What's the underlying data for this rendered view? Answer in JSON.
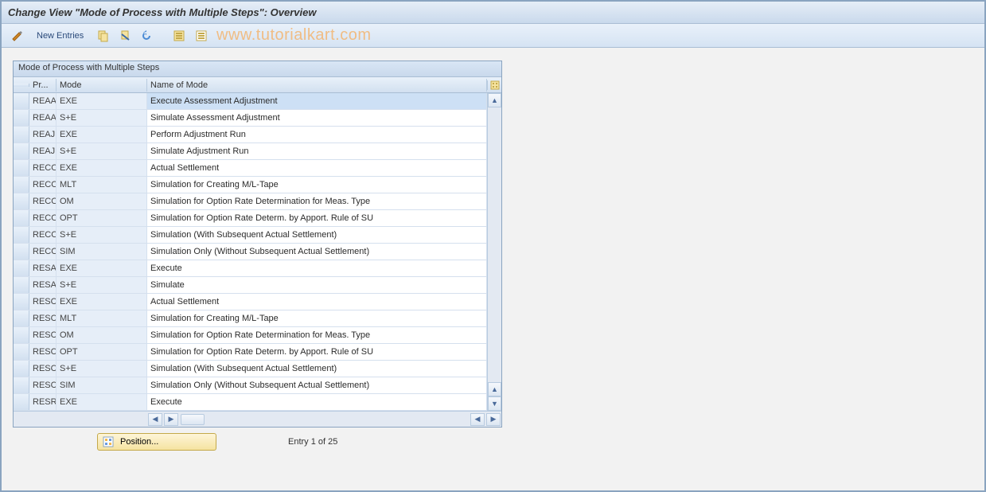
{
  "title": "Change View \"Mode of Process with Multiple Steps\": Overview",
  "toolbar": {
    "new_entries": "New Entries"
  },
  "watermark": "www.tutorialkart.com",
  "table": {
    "caption": "Mode of Process with Multiple Steps",
    "headers": {
      "pr": "Pr...",
      "mode": "Mode",
      "name": "Name of Mode"
    },
    "rows": [
      {
        "pr": "REAA",
        "mode": "EXE",
        "name": "Execute Assessment Adjustment",
        "highlight": true
      },
      {
        "pr": "REAA",
        "mode": "S+E",
        "name": "Simulate Assessment Adjustment"
      },
      {
        "pr": "REAJ",
        "mode": "EXE",
        "name": "Perform Adjustment Run"
      },
      {
        "pr": "REAJ",
        "mode": "S+E",
        "name": "Simulate Adjustment Run"
      },
      {
        "pr": "RECO",
        "mode": "EXE",
        "name": "Actual Settlement"
      },
      {
        "pr": "RECO",
        "mode": "MLT",
        "name": "Simulation for Creating M/L-Tape"
      },
      {
        "pr": "RECO",
        "mode": "OM",
        "name": "Simulation for Option Rate Determination for Meas. Type"
      },
      {
        "pr": "RECO",
        "mode": "OPT",
        "name": "Simulation for Option Rate Determ. by Apport. Rule of SU"
      },
      {
        "pr": "RECO",
        "mode": "S+E",
        "name": "Simulation (With Subsequent Actual Settlement)"
      },
      {
        "pr": "RECO",
        "mode": "SIM",
        "name": "Simulation Only (Without Subsequent Actual Settlement)"
      },
      {
        "pr": "RESA",
        "mode": "EXE",
        "name": "Execute"
      },
      {
        "pr": "RESA",
        "mode": "S+E",
        "name": "Simulate"
      },
      {
        "pr": "RESC",
        "mode": "EXE",
        "name": "Actual Settlement"
      },
      {
        "pr": "RESC",
        "mode": "MLT",
        "name": "Simulation for Creating M/L-Tape"
      },
      {
        "pr": "RESC",
        "mode": "OM",
        "name": "Simulation for Option Rate Determination for Meas. Type"
      },
      {
        "pr": "RESC",
        "mode": "OPT",
        "name": "Simulation for Option Rate Determ. by Apport. Rule of SU"
      },
      {
        "pr": "RESC",
        "mode": "S+E",
        "name": "Simulation (With Subsequent Actual Settlement)"
      },
      {
        "pr": "RESC",
        "mode": "SIM",
        "name": "Simulation Only (Without Subsequent Actual Settlement)"
      },
      {
        "pr": "RESR",
        "mode": "EXE",
        "name": "Execute"
      }
    ]
  },
  "footer": {
    "position_label": "Position...",
    "entry_text": "Entry 1 of 25"
  }
}
